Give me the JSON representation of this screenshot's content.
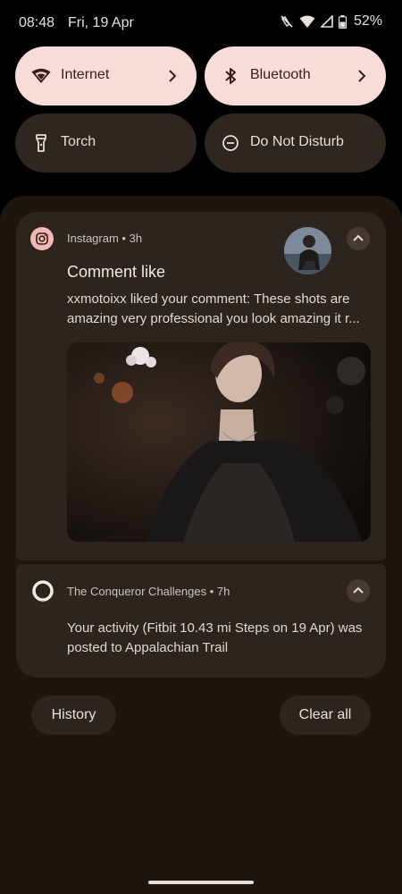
{
  "status_bar": {
    "time": "08:48",
    "date": "Fri, 19 Apr",
    "battery": "52%",
    "icons": [
      "vibrate-off-icon",
      "wifi-icon",
      "signal-icon",
      "battery-icon"
    ]
  },
  "quick_settings": [
    {
      "label": "Internet",
      "icon": "wifi-icon",
      "state": "on",
      "has_chevron": true
    },
    {
      "label": "Bluetooth",
      "icon": "bluetooth-icon",
      "state": "on",
      "has_chevron": true
    },
    {
      "label": "Torch",
      "icon": "torch-icon",
      "state": "off",
      "has_chevron": false
    },
    {
      "label": "Do Not Disturb",
      "icon": "dnd-icon",
      "state": "off",
      "has_chevron": false
    }
  ],
  "notifications": [
    {
      "app": "Instagram",
      "time": "3h",
      "title": "Comment like",
      "body_line1": "xxmotoixx liked your comment: These shots are",
      "body_line2": "amazing very professional you look amazing it r..."
    },
    {
      "app": "The Conqueror Challenges",
      "time": "7h",
      "body_line1": "Your activity (Fitbit 10.43 mi Steps on 19 Apr) was",
      "body_line2": "posted to Appalachian Trail"
    }
  ],
  "footer": {
    "history_label": "History",
    "clear_all_label": "Clear all"
  },
  "colors": {
    "tile_on": "#f7dcd8",
    "tile_off": "#2f2521",
    "card": "#2d241f",
    "shade": "#1d1510"
  }
}
